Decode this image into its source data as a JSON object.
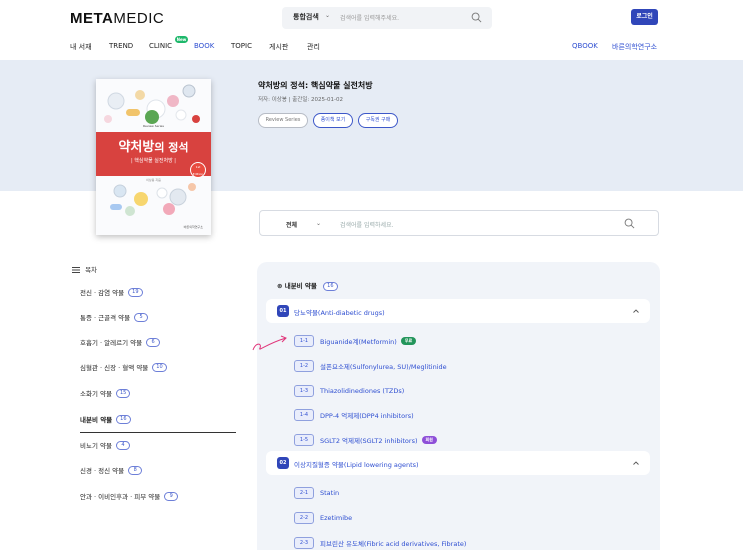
{
  "colors": {
    "brand_blue": "#3046b9",
    "link_blue": "#2f4fd1",
    "hero_bg": "#e6ecf5",
    "cover_red": "#d8423f",
    "free_green": "#23955b",
    "member_purple": "#8e4fd8",
    "new_green": "#1eb86b"
  },
  "header": {
    "logo_bold": "META",
    "logo_light": "MEDIC",
    "search_scope": "통합검색",
    "search_placeholder": "검색어를 입력해주세요.",
    "search_icon": "search-icon",
    "login_label": "로그인"
  },
  "nav": {
    "items": [
      "내 서재",
      "TREND",
      "CLINIC",
      "BOOK",
      "TOPIC",
      "게시판",
      "관리"
    ],
    "active": "BOOK",
    "clinic_badge": "New",
    "right_items": [
      "QBOOK",
      "바른의학연구소"
    ]
  },
  "book": {
    "title": "약처방의 정석: 핵심약물 실전처방",
    "meta": "저자: 이상봉 | 출간일: 2025-01-02",
    "buttons": [
      "Review Series",
      "종이책 보기",
      "구독권 구매"
    ],
    "cover": {
      "series": "Review Series",
      "title_main": "약처방",
      "title_suffix": "의 정석",
      "subtitle": "| 핵심약물 실전처방 |",
      "author": "이상봉 지음",
      "edition": "1st Edition",
      "publisher": "바른의학연구소"
    }
  },
  "content_search": {
    "scope": "전체",
    "placeholder": "검색어를 입력하세요.",
    "icon": "search-icon"
  },
  "toc": {
    "heading": "목차",
    "items": [
      {
        "label": "전신 · 감염 약물",
        "count": "19"
      },
      {
        "label": "통증 · 근골격 약물",
        "count": "5"
      },
      {
        "label": "호흡기 · 알레르기 약물",
        "count": "6"
      },
      {
        "label": "심혈관 · 신장 · 혈액 약물",
        "count": "10"
      },
      {
        "label": "소화기 약물",
        "count": "15"
      },
      {
        "label": "내분비 약물",
        "count": "16"
      },
      {
        "label": "비뇨기 약물",
        "count": "4"
      },
      {
        "label": "신경 · 정신 약물",
        "count": "8"
      },
      {
        "label": "안과 · 이비인후과 · 피부 약물",
        "count": "9"
      }
    ],
    "active_index": 5
  },
  "panel": {
    "title": "내분비 약물",
    "count": "16",
    "chapters": [
      {
        "num": "01",
        "title": "당뇨약물(Anti-diabetic drugs)",
        "sections": [
          {
            "num": "1-1",
            "title": "Biguanide계(Metformin)",
            "tag": "무료"
          },
          {
            "num": "1-2",
            "title": "설폰요소제(Sulfonylurea, SU)/Meglitinide",
            "tag": ""
          },
          {
            "num": "1-3",
            "title": "Thiazolidinediones (TZDs)",
            "tag": ""
          },
          {
            "num": "1-4",
            "title": "DPP-4 억제제(DPP4 inhibitors)",
            "tag": ""
          },
          {
            "num": "1-5",
            "title": "SGLT2 억제제(SGLT2 inhibitors)",
            "tag": "회원"
          }
        ]
      },
      {
        "num": "02",
        "title": "이상지질혈증 약물(Lipid lowering agents)",
        "sections": [
          {
            "num": "2-1",
            "title": "Statin",
            "tag": ""
          },
          {
            "num": "2-2",
            "title": "Ezetimibe",
            "tag": ""
          },
          {
            "num": "2-3",
            "title": "피브린산 유도체(Fibric acid derivatives, Fibrate)",
            "tag": ""
          }
        ]
      }
    ]
  }
}
